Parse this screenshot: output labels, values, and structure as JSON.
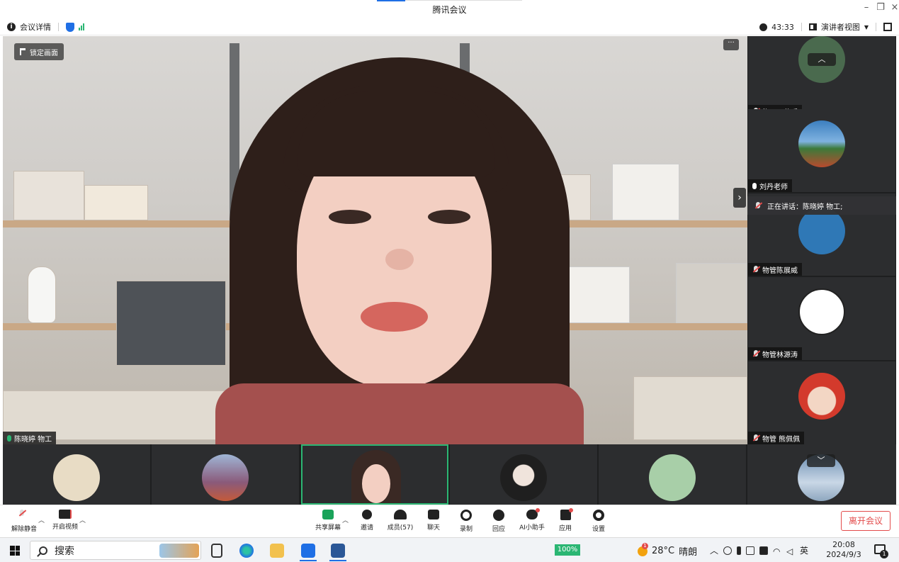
{
  "window": {
    "title": "腾讯会议"
  },
  "infobar": {
    "meeting_details": "会议详情",
    "timer": "43:33",
    "view_mode": "演讲者视图"
  },
  "stage": {
    "lock_label": "锁定画面",
    "more_label": "···",
    "speaker_name": "陈晓婷 物工"
  },
  "side_participants": [
    {
      "name": "物工王菲瑶",
      "mic": "muted",
      "avatar_color": "#4a6a4e"
    },
    {
      "name": "刘丹老师",
      "mic": "on",
      "avatar_color": "#3c7fbf"
    },
    {
      "name": "物管陈展威",
      "mic": "muted",
      "avatar_color": "#2f78b6"
    },
    {
      "name": "物管林源涛",
      "mic": "muted",
      "avatar_color": "#ffffff"
    },
    {
      "name": "物管 熊佩佩",
      "mic": "muted",
      "avatar_color": "#d33a2c"
    }
  ],
  "speaking": {
    "label": "正在讲话：陈晓婷 物工;"
  },
  "filmstrip": [
    {
      "avatar_color": "#e8dcc5"
    },
    {
      "avatar_color": "#8a5a7a"
    },
    {
      "avatar_color": "#3a2924",
      "active": true
    },
    {
      "avatar_color": "#e9e6e2"
    },
    {
      "avatar_color": "#a8cfa8"
    },
    {
      "avatar_color": "#6d8fb3"
    }
  ],
  "toolbar": {
    "unmute": "解除静音",
    "start_video": "开启视频",
    "share_screen": "共享屏幕",
    "invite": "邀请",
    "members": "成员(57)",
    "chat": "聊天",
    "record": "录制",
    "react": "回应",
    "ai_assistant": "AI小助手",
    "apps": "应用",
    "settings": "设置",
    "leave": "离开会议"
  },
  "taskbar": {
    "search_placeholder": "搜索",
    "battery": "100%",
    "weather_temp": "28°C",
    "weather_desc": "晴朗",
    "weather_badge": "1",
    "ime": "英",
    "time": "20:08",
    "date": "2024/9/3",
    "notification_count": "1"
  },
  "colors": {
    "accent": "#1f6fe5",
    "speaking_green": "#2bb673",
    "leave_red": "#e34b4b"
  }
}
